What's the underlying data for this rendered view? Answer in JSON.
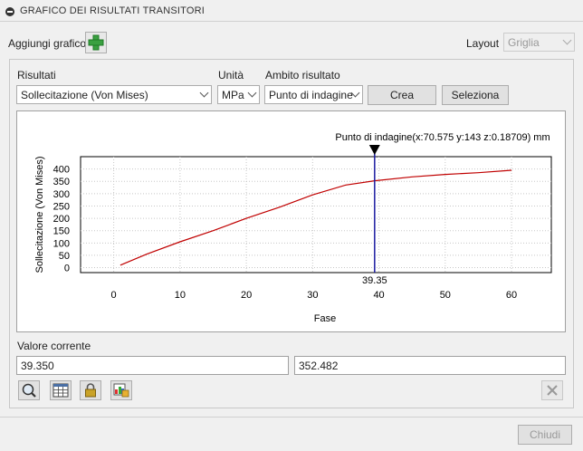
{
  "title": "GRAFICO DEI RISULTATI TRANSITORI",
  "toolbar": {
    "add_chart_label": "Aggiungi grafico",
    "layout_label": "Layout",
    "layout_value": "Griglia"
  },
  "filters": {
    "results_label": "Risultati",
    "results_value": "Sollecitazione (Von Mises)",
    "unit_label": "Unità",
    "unit_value": "MPa",
    "scope_label": "Ambito risultato",
    "scope_value": "Punto di indagine",
    "create_label": "Crea",
    "select_label": "Seleziona"
  },
  "chart_data": {
    "type": "line",
    "probe_label": "Punto di indagine(x:70.575 y:143 z:0.18709) mm",
    "xlabel": "Fase",
    "ylabel": "Sollecitazione (Von Mises)",
    "xlim": [
      -5,
      66
    ],
    "ylim": [
      -20,
      450
    ],
    "xticks": [
      0,
      10,
      20,
      30,
      40,
      50,
      60
    ],
    "yticks": [
      0,
      50,
      100,
      150,
      200,
      250,
      300,
      350,
      400
    ],
    "cursor_x": 39.35,
    "cursor_label": "39.35",
    "grid": true,
    "line_color": "#c00000",
    "cursor_color": "#1a1aa0",
    "series": [
      {
        "x": [
          1,
          5,
          10,
          15,
          20,
          25,
          30,
          35,
          39.35,
          45,
          50,
          55,
          60
        ],
        "values": [
          10,
          55,
          105,
          150,
          200,
          245,
          295,
          335,
          352.482,
          368,
          378,
          385,
          395
        ]
      }
    ]
  },
  "current": {
    "label": "Valore corrente",
    "x_value": "39.350",
    "y_value": "352.482"
  },
  "icons": [
    "zoom-icon",
    "table-icon",
    "lock-icon",
    "chart-settings-icon",
    "delete-icon"
  ],
  "footer": {
    "close_label": "Chiudi"
  }
}
